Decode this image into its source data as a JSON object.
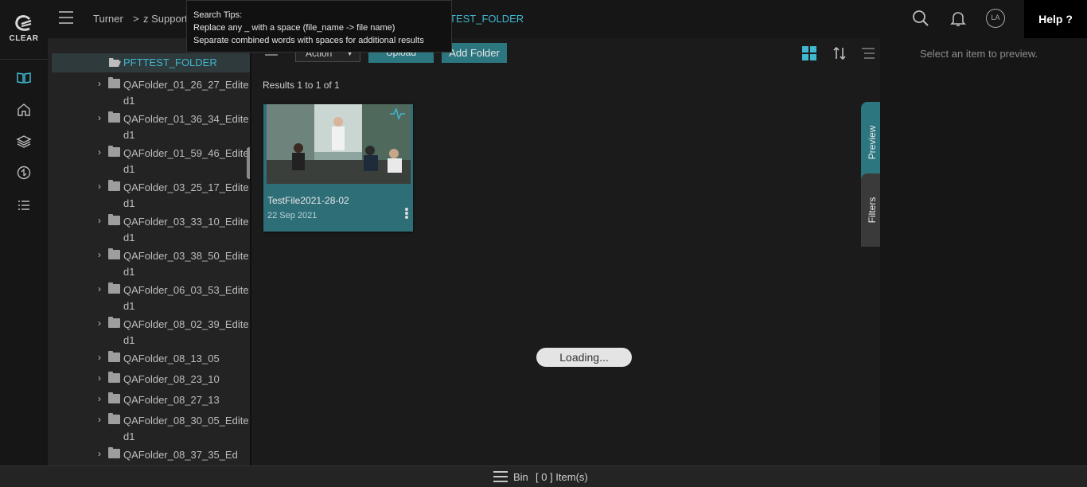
{
  "app": {
    "logo_text": "CLEAR",
    "accent_color": "#3fb8d0",
    "button_color": "#2c7680"
  },
  "rail": {
    "icons": [
      "book-icon",
      "home-icon",
      "layers-icon",
      "sync-icon",
      "list-icon"
    ]
  },
  "header": {
    "breadcrumbs": [
      "Turner",
      "z Support",
      "PFTTEST_FOLDER"
    ],
    "breadcrumb_sep": ">",
    "current_partial": "TEST_FOLDER",
    "avatar_initials": "LA",
    "help_label": "Help ?"
  },
  "tooltip": {
    "line1": "Search Tips:",
    "line2": "Replace any _ with a space (file_name -> file name)",
    "line3": "Separate combined words with spaces for additional results"
  },
  "tree": {
    "selected": "PFTTEST_FOLDER",
    "items": [
      "QAFolder_01_26_27_Edited1",
      "QAFolder_01_36_34_Edited1",
      "QAFolder_01_59_46_Edited1",
      "QAFolder_03_25_17_Edited1",
      "QAFolder_03_33_10_Edited1",
      "QAFolder_03_38_50_Edited1",
      "QAFolder_06_03_53_Edited1",
      "QAFolder_08_02_39_Edited1",
      "QAFolder_08_13_05",
      "QAFolder_08_23_10",
      "QAFolder_08_27_13",
      "QAFolder_08_30_05_Edited1",
      "QAFolder_08_37_35_Ed"
    ]
  },
  "toolbar": {
    "action_label": "Action",
    "upload_label": "Upload",
    "add_folder_label": "Add Folder"
  },
  "results": {
    "text": "Results 1 to 1 of 1"
  },
  "card": {
    "title": "TestFile2021-28-02",
    "date": "22 Sep 2021"
  },
  "loading": {
    "text": "Loading..."
  },
  "tabs": {
    "preview": "Preview",
    "filters": "Filters"
  },
  "preview": {
    "message": "Select an item to preview."
  },
  "bin": {
    "label": "Bin",
    "count": "[ 0 ] Item(s)"
  }
}
